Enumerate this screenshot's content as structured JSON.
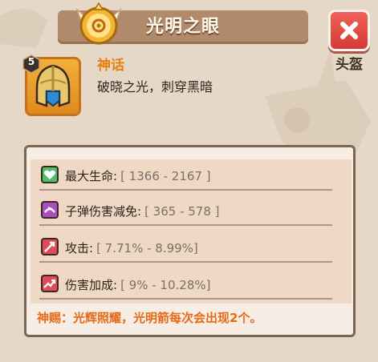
{
  "header": {
    "title": "光明之眼"
  },
  "close_button": {
    "icon": "close-icon",
    "color": "#dd463f"
  },
  "slot": {
    "label": "头盔"
  },
  "item": {
    "level": "5",
    "rarity": "神话",
    "description": "破晓之光，刺穿黑暗",
    "icon": "helmet-icon"
  },
  "stats": [
    {
      "label": "最大生命:",
      "range": "[ 1366 - 2167 ]",
      "icon": "heart-icon",
      "color": "#4dbf6a"
    },
    {
      "label": "子弹伤害减免:",
      "range": "[ 365 - 578 ]",
      "icon": "bullet-shield-icon",
      "color": "#a94fc1"
    },
    {
      "label": "攻击:",
      "range": "[ 7.71% - 8.99%]",
      "icon": "attack-icon",
      "color": "#e04a5d"
    },
    {
      "label": "伤害加成:",
      "range": "[ 9% - 10.28%]",
      "icon": "damage-boost-icon",
      "color": "#e04a5d"
    }
  ],
  "blessing": "神赐：光辉照耀，光明箭每次会出现2个。",
  "colors": {
    "accent": "#e58012",
    "blessing": "#e66a19",
    "header": "#b1896b"
  }
}
